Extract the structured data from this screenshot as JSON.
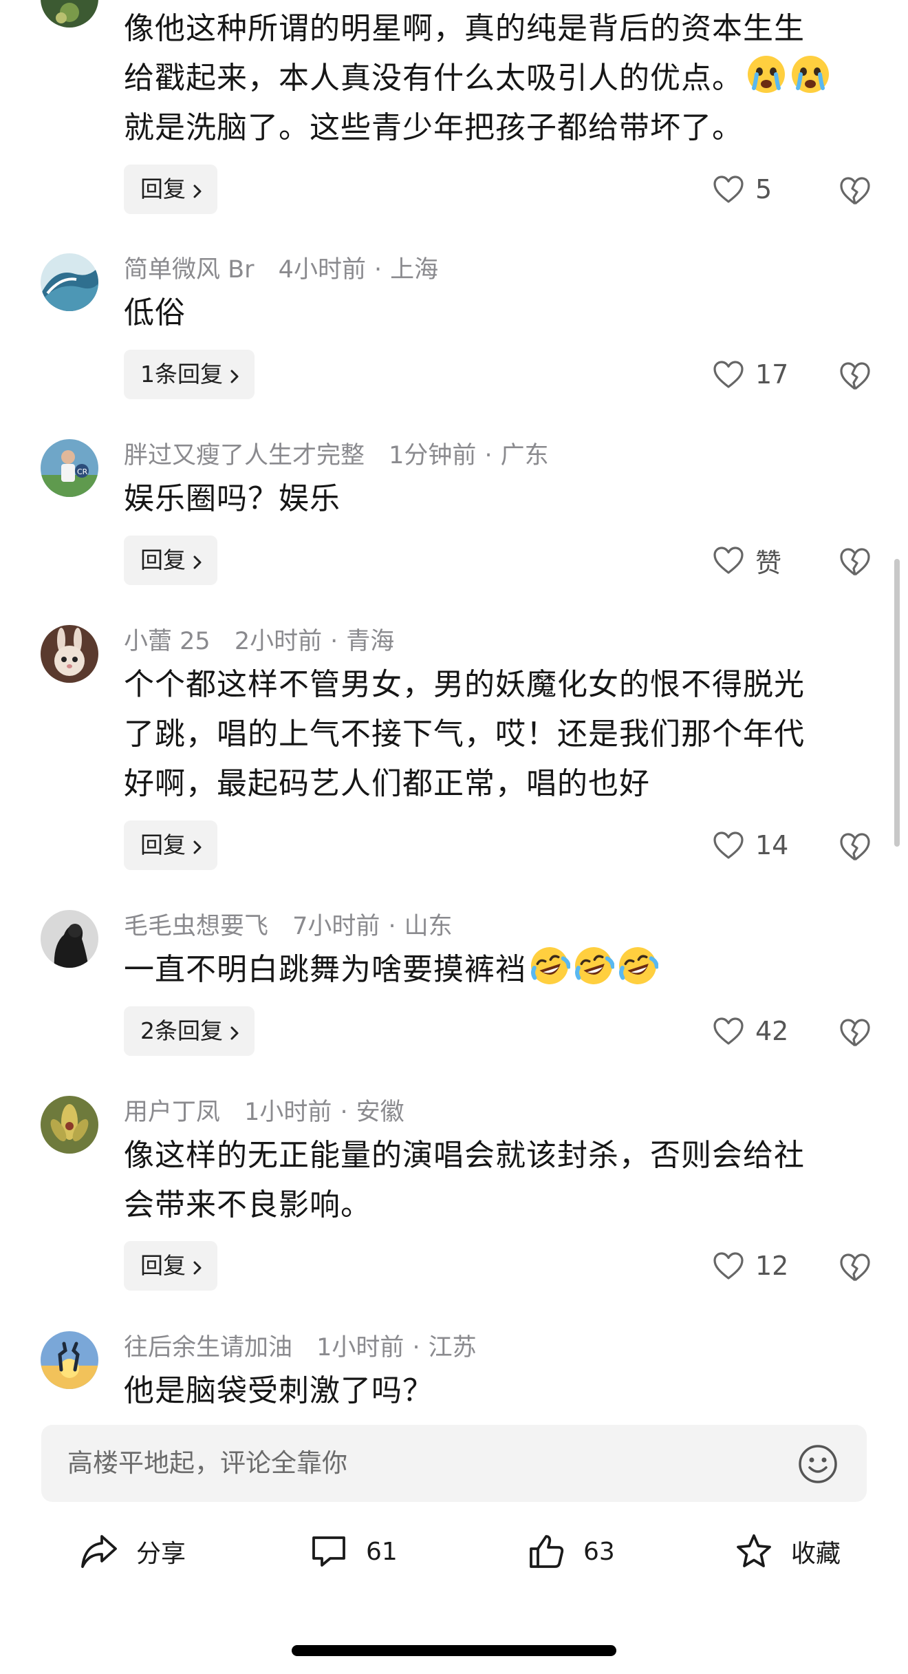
{
  "comments": [
    {
      "user": "",
      "time": "",
      "location": "",
      "text_lines": [
        "像他这种所谓的明星啊，真的纯是背后的资本生生",
        "给戳起来，本人真没有什么太吸引人的优点。",
        "就是洗脑了。这些青少年把孩子都给带坏了。"
      ],
      "emoji": "crying-face",
      "reply_label": "回复",
      "likes": "5"
    },
    {
      "user": "简单微风 Br",
      "time": "4小时前",
      "location": "上海",
      "text_lines": [
        "低俗"
      ],
      "reply_label": "1条回复",
      "likes": "17"
    },
    {
      "user": "胖过又瘦了人生才完整",
      "time": "1分钟前",
      "location": "广东",
      "text_lines": [
        "娱乐圈吗？娱乐"
      ],
      "reply_label": "回复",
      "likes": "赞"
    },
    {
      "user": "小蕾 25",
      "time": "2小时前",
      "location": "青海",
      "text_lines": [
        "个个都这样不管男女，男的妖魔化女的恨不得脱光",
        "了跳，唱的上气不接下气，哎！还是我们那个年代",
        "好啊，最起码艺人们都正常，唱的也好"
      ],
      "reply_label": "回复",
      "likes": "14"
    },
    {
      "user": "毛毛虫想要飞",
      "time": "7小时前",
      "location": "山东",
      "text_lines": [
        "一直不明白跳舞为啥要摸裤裆"
      ],
      "emoji": "laughing-crying-face",
      "reply_label": "2条回复",
      "likes": "42"
    },
    {
      "user": "用户丁凤",
      "time": "1小时前",
      "location": "安徽",
      "text_lines": [
        "像这样的无正能量的演唱会就该封杀，否则会给社",
        "会带来不良影响。"
      ],
      "reply_label": "回复",
      "likes": "12"
    },
    {
      "user": "往后余生请加油",
      "time": "1小时前",
      "location": "江苏",
      "text_lines": [
        "他是脑袋受刺激了吗？"
      ]
    }
  ],
  "input": {
    "placeholder": "高楼平地起，评论全靠你",
    "icon": "smile-icon"
  },
  "actions": {
    "share_label": "分享",
    "comment_count": "61",
    "like_count": "63",
    "collect_label": "收藏"
  },
  "colors": {
    "meta_text": "#8a8a8e",
    "reply_bg": "#f2f2f2",
    "input_bg": "#f3f3f3"
  }
}
